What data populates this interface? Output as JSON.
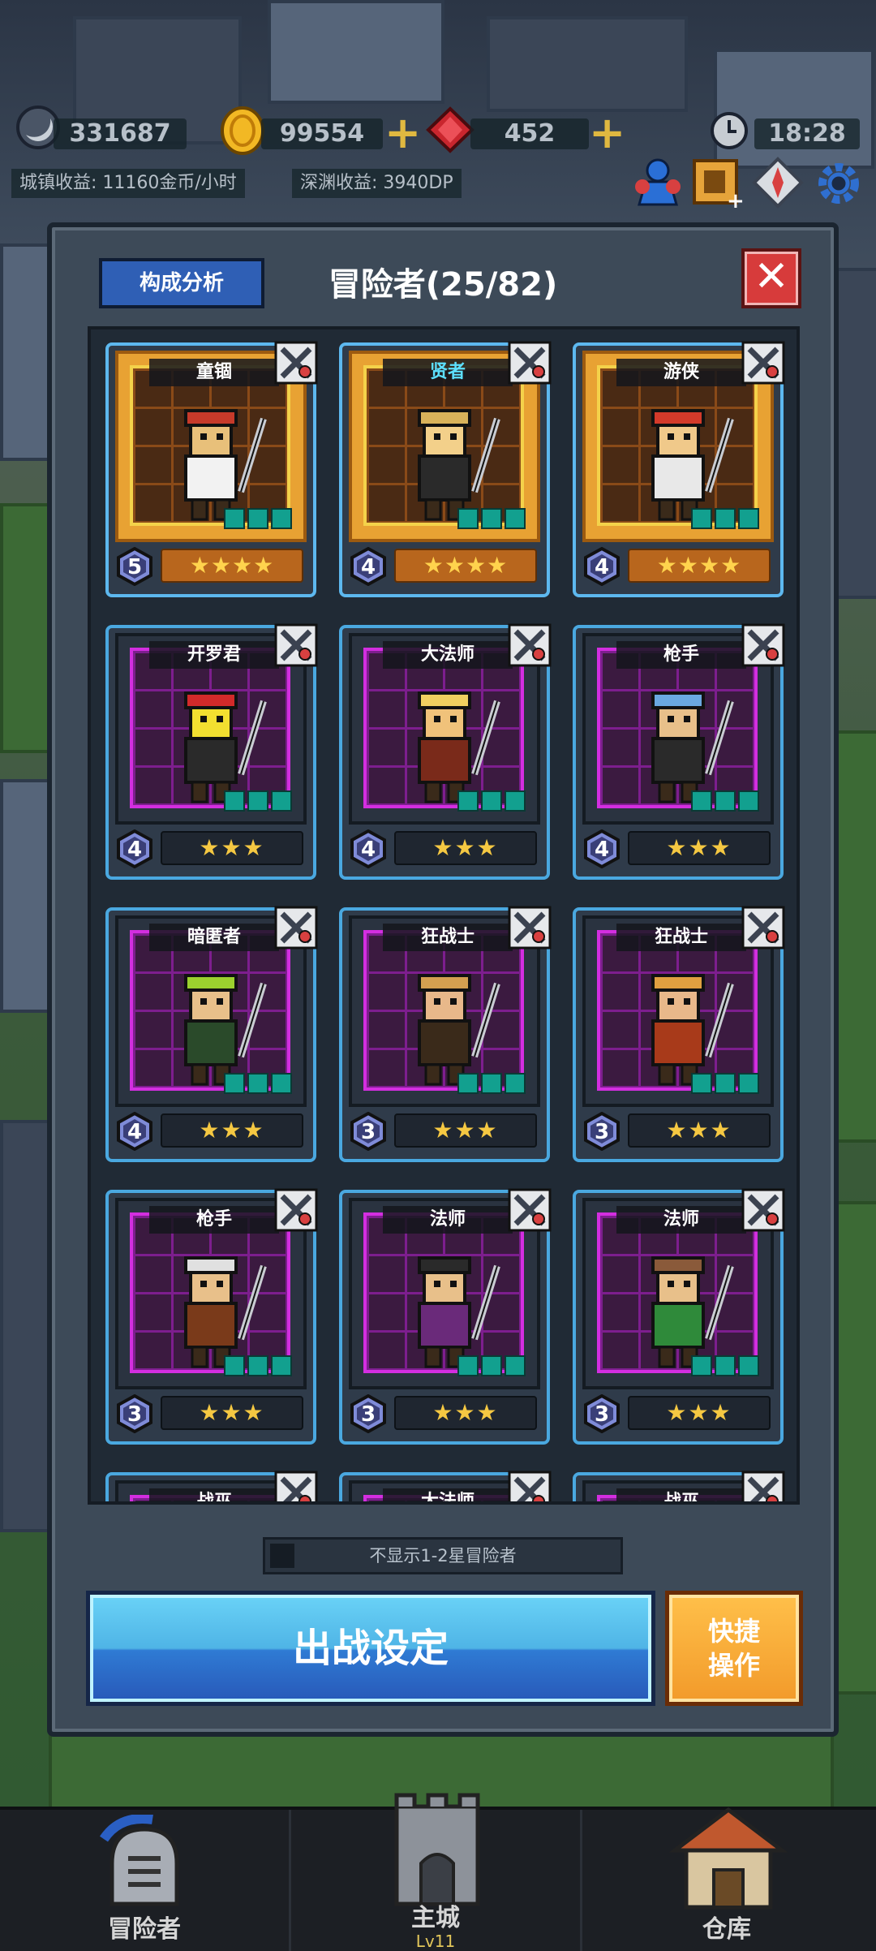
{
  "hud": {
    "moon_value": "331687",
    "coin_value": "99554",
    "gem_value": "452",
    "clock": "18:28",
    "town_income": "城镇收益: 11160金币/小时",
    "abyss_income": "深渊收益: 3940DP"
  },
  "panel": {
    "analysis_button": "构成分析",
    "title": "冒险者(25/82)",
    "filter_label": "不显示1-2星冒险者",
    "deploy_button": "出战设定",
    "quick_button_line1": "快捷",
    "quick_button_line2": "操作"
  },
  "cards": [
    {
      "name": "童锢",
      "level": "5",
      "stars": "★★★★",
      "tier": "gold",
      "name_color": "white"
    },
    {
      "name": "贤者",
      "level": "4",
      "stars": "★★★★",
      "tier": "gold",
      "name_color": "cyan"
    },
    {
      "name": "游侠",
      "level": "4",
      "stars": "★★★★",
      "tier": "gold",
      "name_color": "white"
    },
    {
      "name": "开罗君",
      "level": "4",
      "stars": "★★★",
      "tier": "purple",
      "name_color": "white"
    },
    {
      "name": "大法师",
      "level": "4",
      "stars": "★★★",
      "tier": "purple",
      "name_color": "white"
    },
    {
      "name": "枪手",
      "level": "4",
      "stars": "★★★",
      "tier": "purple",
      "name_color": "white"
    },
    {
      "name": "暗匿者",
      "level": "4",
      "stars": "★★★",
      "tier": "purple",
      "name_color": "white"
    },
    {
      "name": "狂战士",
      "level": "3",
      "stars": "★★★",
      "tier": "purple",
      "name_color": "white"
    },
    {
      "name": "狂战士",
      "level": "3",
      "stars": "★★★",
      "tier": "purple",
      "name_color": "white"
    },
    {
      "name": "枪手",
      "level": "3",
      "stars": "★★★",
      "tier": "purple",
      "name_color": "white"
    },
    {
      "name": "法师",
      "level": "3",
      "stars": "★★★",
      "tier": "purple",
      "name_color": "white"
    },
    {
      "name": "法师",
      "level": "3",
      "stars": "★★★",
      "tier": "purple",
      "name_color": "white"
    },
    {
      "name": "战巫",
      "level": "",
      "stars": "",
      "tier": "purple",
      "name_color": "white"
    },
    {
      "name": "大法师",
      "level": "",
      "stars": "",
      "tier": "purple",
      "name_color": "white"
    },
    {
      "name": "战巫",
      "level": "",
      "stars": "",
      "tier": "purple",
      "name_color": "white"
    }
  ],
  "nav": {
    "adventurer": "冒险者",
    "main_city": "主城",
    "main_city_level": "Lv11",
    "warehouse": "仓库"
  },
  "colors": {
    "card_border": "#4aa8e0",
    "gold_frame": "#e8a233",
    "purple_grid": "#d32ee0",
    "deploy_button": "#4fb4e6",
    "quick_button": "#f29a2a",
    "close_button": "#d73b3b"
  }
}
